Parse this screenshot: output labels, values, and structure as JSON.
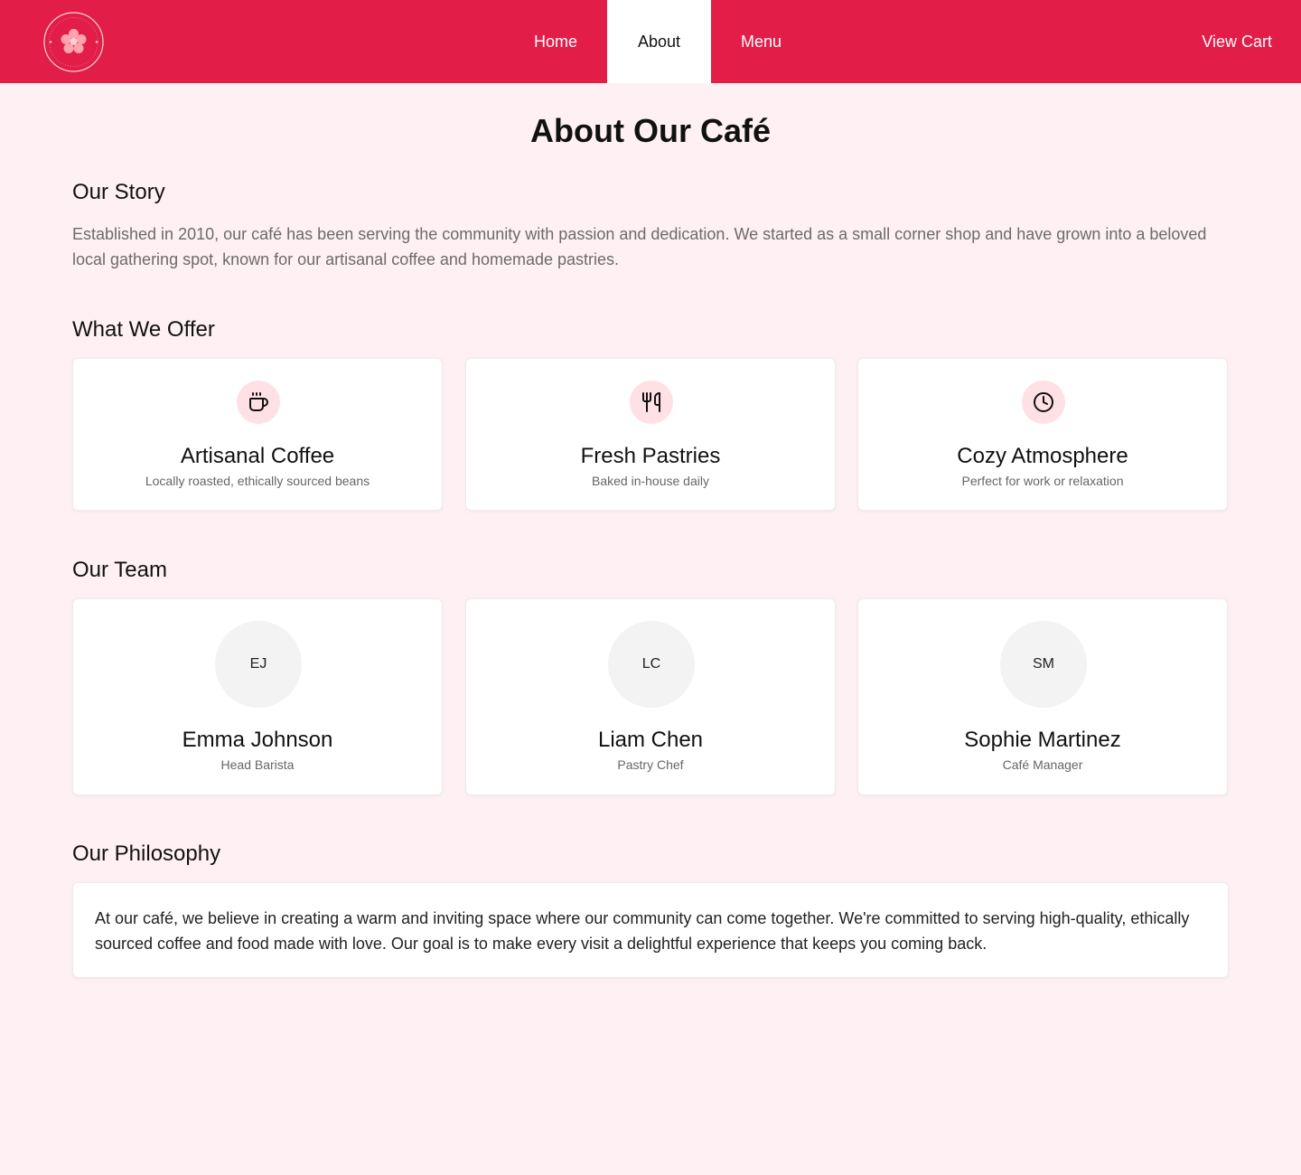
{
  "nav": {
    "logo": "bloom-cafe-logo",
    "links": [
      {
        "label": "Home",
        "active": false
      },
      {
        "label": "About",
        "active": true
      },
      {
        "label": "Menu",
        "active": false
      }
    ],
    "cart_label": "View Cart"
  },
  "page_title": "About Our Café",
  "story": {
    "title": "Our Story",
    "text": "Established in 2010, our café has been serving the community with passion and dedication. We started as a small corner shop and have grown into a beloved local gathering spot, known for our artisanal coffee and homemade pastries."
  },
  "offer": {
    "title": "What We Offer",
    "items": [
      {
        "icon": "coffee-cup-icon",
        "title": "Artisanal Coffee",
        "desc": "Locally roasted, ethically sourced beans"
      },
      {
        "icon": "utensils-icon",
        "title": "Fresh Pastries",
        "desc": "Baked in-house daily"
      },
      {
        "icon": "clock-icon",
        "title": "Cozy Atmosphere",
        "desc": "Perfect for work or relaxation"
      }
    ]
  },
  "team": {
    "title": "Our Team",
    "members": [
      {
        "initials": "EJ",
        "name": "Emma Johnson",
        "role": "Head Barista"
      },
      {
        "initials": "LC",
        "name": "Liam Chen",
        "role": "Pastry Chef"
      },
      {
        "initials": "SM",
        "name": "Sophie Martinez",
        "role": "Café Manager"
      }
    ]
  },
  "philosophy": {
    "title": "Our Philosophy",
    "text": "At our café, we believe in creating a warm and inviting space where our community can come together. We're committed to serving high-quality, ethically sourced coffee and food made with love. Our goal is to make every visit a delightful experience that keeps you coming back."
  },
  "colors": {
    "brand": "#e11d48",
    "background": "#fff0f3",
    "icon_bg": "#ffe1e5"
  }
}
